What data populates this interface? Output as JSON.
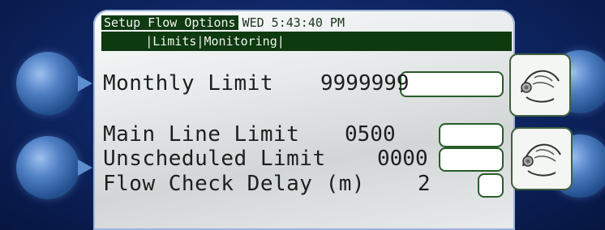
{
  "header": {
    "title": "Setup Flow Options",
    "datetime": "WED 5:43:40 PM"
  },
  "tabs": [
    {
      "label": "Limits"
    },
    {
      "label": "Monitoring"
    }
  ],
  "fields": {
    "monthly_limit": {
      "label": "Monthly Limit",
      "value": "9999999"
    },
    "main_line_limit": {
      "label": "Main Line Limit",
      "value": "0500"
    },
    "unscheduled_limit": {
      "label": "Unscheduled Limit",
      "value": "0000"
    },
    "flow_check_delay": {
      "label": "Flow Check Delay (m)",
      "value": "2"
    }
  },
  "icons": {
    "hand_top": "touch-hand-icon",
    "hand_bottom": "touch-hand-icon"
  },
  "colors": {
    "title_bar": "#0f3a12",
    "screen": "#e6eaea",
    "box_border": "#285c2a",
    "bezel": "#0d2460"
  }
}
